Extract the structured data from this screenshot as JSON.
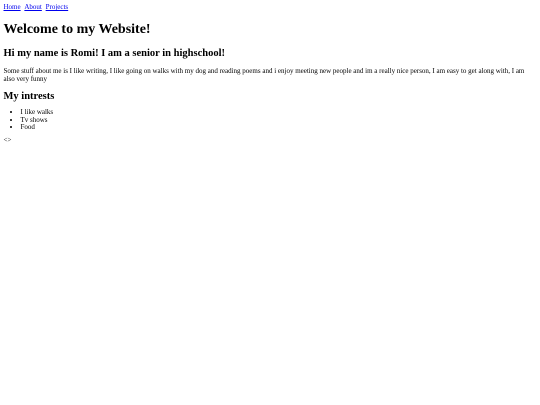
{
  "nav": {
    "links": [
      "Home",
      "About",
      "Projects"
    ]
  },
  "heading": "Welcome to my Website!",
  "intro_heading": "Hi my name is Romi! I am a senior in highschool!",
  "about_text": "Some stuff about me is I like writing, I like going on walks with my dog and reading poems and i enjoy meeting new people and im a really nice person, I am easy to get along with, I am also very funny",
  "interests": {
    "heading": "My intrests",
    "items": [
      "I like walks",
      "Tv shows",
      "Food"
    ]
  },
  "stray_text": "<>",
  "colors": {
    "link": "#0000ee",
    "text": "#000000",
    "background": "#ffffff"
  }
}
